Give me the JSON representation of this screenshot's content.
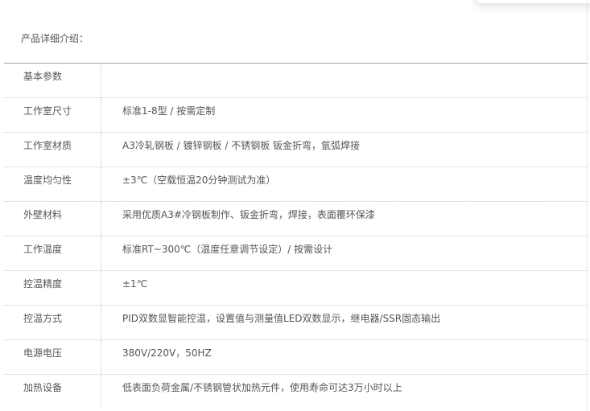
{
  "intro": {
    "title": "产品详细介绍："
  },
  "specs": [
    {
      "label": "基本参数",
      "value": ""
    },
    {
      "label": "工作室尺寸",
      "value": "标准1-8型 / 按需定制"
    },
    {
      "label": "工作室材质",
      "value": "A3冷轧钢板 / 镀锌钢板 / 不锈钢板 钣金折弯，氩弧焊接"
    },
    {
      "label": "温度均匀性",
      "value": "±3℃（空载恒温20分钟测试为准）"
    },
    {
      "label": "外壁材料",
      "value": "采用优质A3#冷钢板制作、钣金折弯，焊接，表面覆环保漆"
    },
    {
      "label": "工作温度",
      "value": "标准RT~300℃（温度任意调节设定）/ 按需设计"
    },
    {
      "label": "控温精度",
      "value": "±1℃"
    },
    {
      "label": "控温方式",
      "value": "PID双数显智能控温，设置值与测量值LED双数显示，继电器/SSR固态输出"
    },
    {
      "label": "电源电压",
      "value": "380V/220V，50HZ"
    },
    {
      "label": "加热设备",
      "value": "低表面负荷金属/不锈钢管状加热元件，使用寿命可达3万小时以上"
    }
  ]
}
